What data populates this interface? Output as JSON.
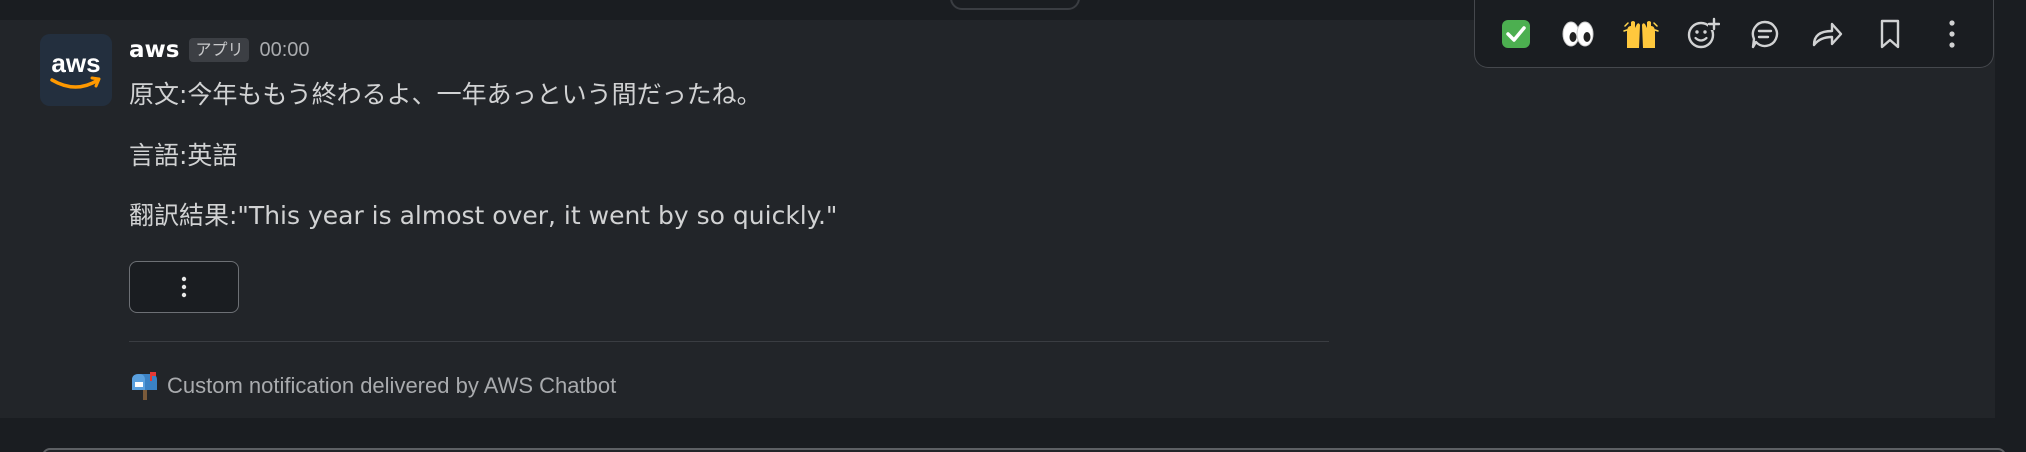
{
  "message": {
    "sender": "aws",
    "app_badge": "アプリ",
    "timestamp": "00:00",
    "lines": [
      "原文:今年ももう終わるよ、一年あっという間だったね。",
      "言語:英語",
      "翻訳結果:\"This year is almost over, it went by so quickly.\""
    ],
    "overflow_button_label": "⋮",
    "footer": {
      "icon": "mailbox-icon",
      "text": "Custom notification delivered by AWS Chatbot"
    }
  },
  "avatar": {
    "logo_text": "aws",
    "icon": "aws-logo-icon"
  },
  "toolbar": {
    "actions": [
      {
        "icon": "white-check-mark-emoji-icon",
        "label": "✅"
      },
      {
        "icon": "eyes-emoji-icon",
        "label": "👀"
      },
      {
        "icon": "raised-hands-emoji-icon",
        "label": "🙌"
      },
      {
        "icon": "add-reaction-icon"
      },
      {
        "icon": "reply-in-thread-icon"
      },
      {
        "icon": "forward-icon"
      },
      {
        "icon": "bookmark-icon"
      },
      {
        "icon": "more-actions-icon"
      }
    ]
  },
  "colors": {
    "background": "#1a1d21",
    "message_background": "#222529",
    "text": "#d1d2d3",
    "muted_text": "#a9abae",
    "aws_orange": "#ff9900",
    "aws_navy": "#232f3e"
  }
}
